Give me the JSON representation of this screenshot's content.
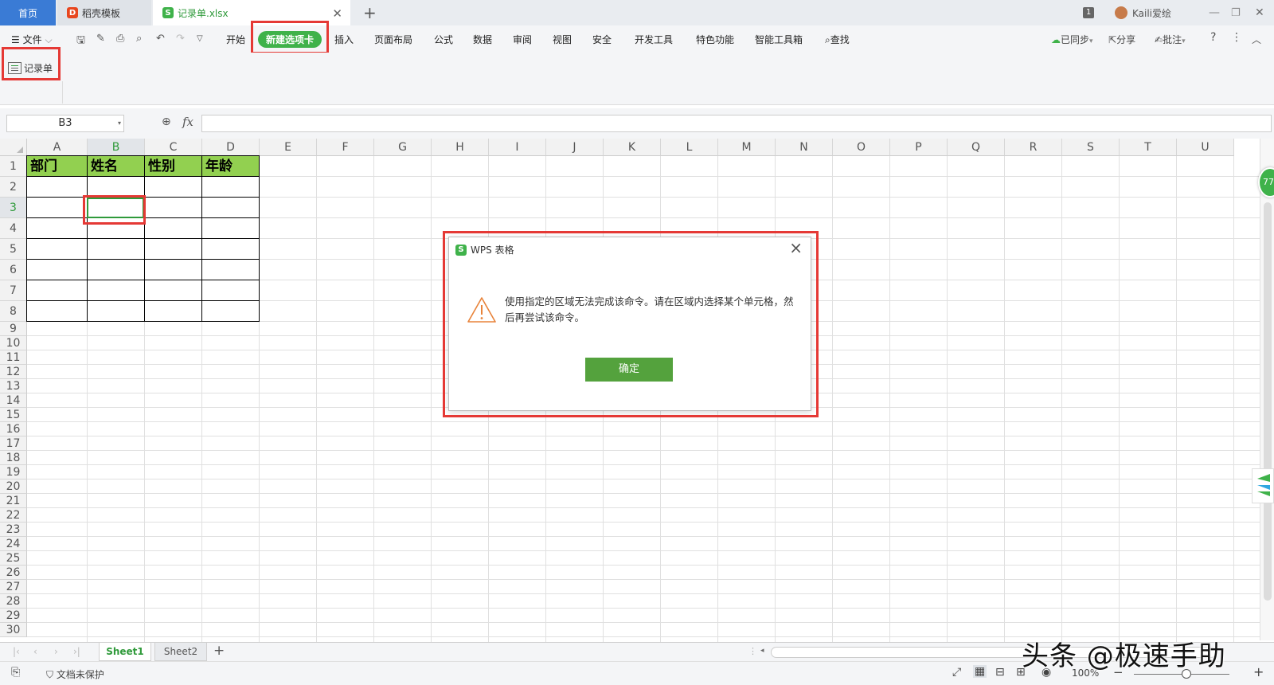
{
  "titlebar": {
    "tabs": [
      {
        "label": "首页"
      },
      {
        "label": "稻壳模板"
      },
      {
        "label": "记录单.xlsx"
      }
    ],
    "window_count": "1",
    "user": "Kaili爱绘"
  },
  "menubar": {
    "file": "文件",
    "items": [
      "开始",
      "新建选项卡",
      "插入",
      "页面布局",
      "公式",
      "数据",
      "审阅",
      "视图",
      "安全",
      "开发工具",
      "特色功能",
      "智能工具箱"
    ],
    "search": "查找",
    "sync": "已同步",
    "share": "分享",
    "comment": "批注"
  },
  "ribbon": {
    "record_form": "记录单"
  },
  "formula_bar": {
    "name_box": "B3",
    "fx": "fx",
    "value": ""
  },
  "grid": {
    "columns": [
      "A",
      "B",
      "C",
      "D",
      "E",
      "F",
      "G",
      "H",
      "I",
      "J",
      "K",
      "L",
      "M",
      "N",
      "O",
      "P",
      "Q",
      "R",
      "S",
      "T",
      "U"
    ],
    "rows": [
      "1",
      "2",
      "3",
      "4",
      "5",
      "6",
      "7",
      "8",
      "9",
      "10",
      "11",
      "12",
      "13",
      "14",
      "15",
      "16",
      "17",
      "18",
      "19",
      "20",
      "21",
      "22",
      "23",
      "24",
      "25",
      "26",
      "27",
      "28",
      "29",
      "30"
    ],
    "selected_column": "B",
    "selected_row": "3",
    "table_headers": [
      "部门",
      "姓名",
      "性别",
      "年龄"
    ],
    "header_fill": "#92d050"
  },
  "float_badge": "77",
  "sheets": {
    "tabs": [
      "Sheet1",
      "Sheet2"
    ],
    "active": "Sheet1"
  },
  "statusbar": {
    "protect": "文档未保护",
    "zoom": "100%"
  },
  "dialog": {
    "title": "WPS 表格",
    "message": "使用指定的区域无法完成该命令。请在区域内选择某个单元格，然后再尝试该命令。",
    "ok": "确定"
  },
  "watermark": "头条 @极速手助",
  "colors": {
    "accent_green": "#3fb24a",
    "highlight_red": "#e53935",
    "home_tab_blue": "#3a7bd5"
  }
}
